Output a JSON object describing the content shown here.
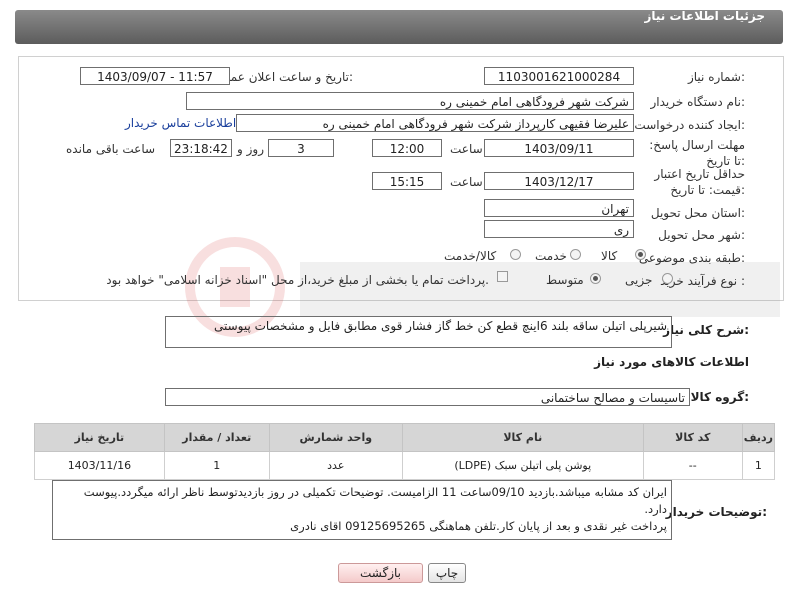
{
  "header": {
    "title": "جزئیات اطلاعات نیاز"
  },
  "form": {
    "need_number_label": "شماره نیاز:",
    "need_number": "1103001621000284",
    "announce_label": "تاریخ و ساعت اعلان عمومی:",
    "announce_value": "1403/09/07 - 11:57",
    "buyer_org_label": "نام دستگاه خریدار:",
    "buyer_org": "شرکت شهر فرودگاهی امام خمینی  ره",
    "requester_label": "ایجاد کننده درخواست:",
    "requester": "علیرضا فقیهی کارپرداز شرکت شهر فرودگاهی امام خمینی  ره",
    "contact_link": "اطلاعات تماس خریدار",
    "deadline_label": "مهلت ارسال پاسخ: تا تاریخ:",
    "deadline_date": "1403/09/11",
    "time_label": "ساعت",
    "deadline_time": "12:00",
    "days_value": "3",
    "days_label": "روز و",
    "remaining_time": "23:18:42",
    "remaining_label": "ساعت باقی مانده",
    "validity_label": "حداقل تاریخ اعتبار قیمت: تا تاریخ:",
    "validity_date": "1403/12/17",
    "validity_time": "15:15",
    "province_label": "استان محل تحویل:",
    "province": "تهران",
    "city_label": "شهر محل تحویل:",
    "city": "ری",
    "category_label": "طبقه بندی موضوعی:",
    "category_options": [
      "کالا",
      "خدمت",
      "کالا/خدمت"
    ],
    "process_label": "نوع فرآیند خرید :",
    "process_options": [
      "جزیی",
      "متوسط"
    ],
    "payment_note": "پرداخت تمام یا بخشی از مبلغ خرید،از محل \"اسناد خزانه اسلامی\" خواهد بود."
  },
  "summary": {
    "label": "شرح کلی نیاز:",
    "text": "شیرپلی اتیلن ساقه بلند 6اینچ قطع کن خط گاز فشار قوی مطابق فایل و مشخصات پیوستی"
  },
  "goods": {
    "section_title": "اطلاعات کالاهای مورد نیاز",
    "group_label": "گروه کالا:",
    "group_value": "تاسیسات و مصالح ساختمانی",
    "columns": [
      "ردیف",
      "کد کالا",
      "نام کالا",
      "واحد شمارش",
      "تعداد / مقدار",
      "تاریخ نیاز"
    ],
    "rows": [
      {
        "row": "1",
        "code": "--",
        "name": "پوشن پلی اتیلن سبک (LDPE)",
        "unit": "عدد",
        "qty": "1",
        "date": "1403/11/16"
      }
    ]
  },
  "buyer_notes": {
    "label": "توضیحات خریدار:",
    "text": "ایران کد مشابه میباشد.بازدید 09/10ساعت 11 الزامیست. توضیحات تکمیلی در روز بازدیدتوسط ناظر ارائه میگردد.پیوست دارد.\nپرداخت غیر نقدی و بعد از پایان کار.تلفن هماهنگی 09125695265 اقای نادری"
  },
  "buttons": {
    "print": "چاپ",
    "back": "بازگشت"
  },
  "colors": {
    "header": "#6e6e6e",
    "link": "#1a3f9c",
    "back_button": "#f4caca"
  }
}
